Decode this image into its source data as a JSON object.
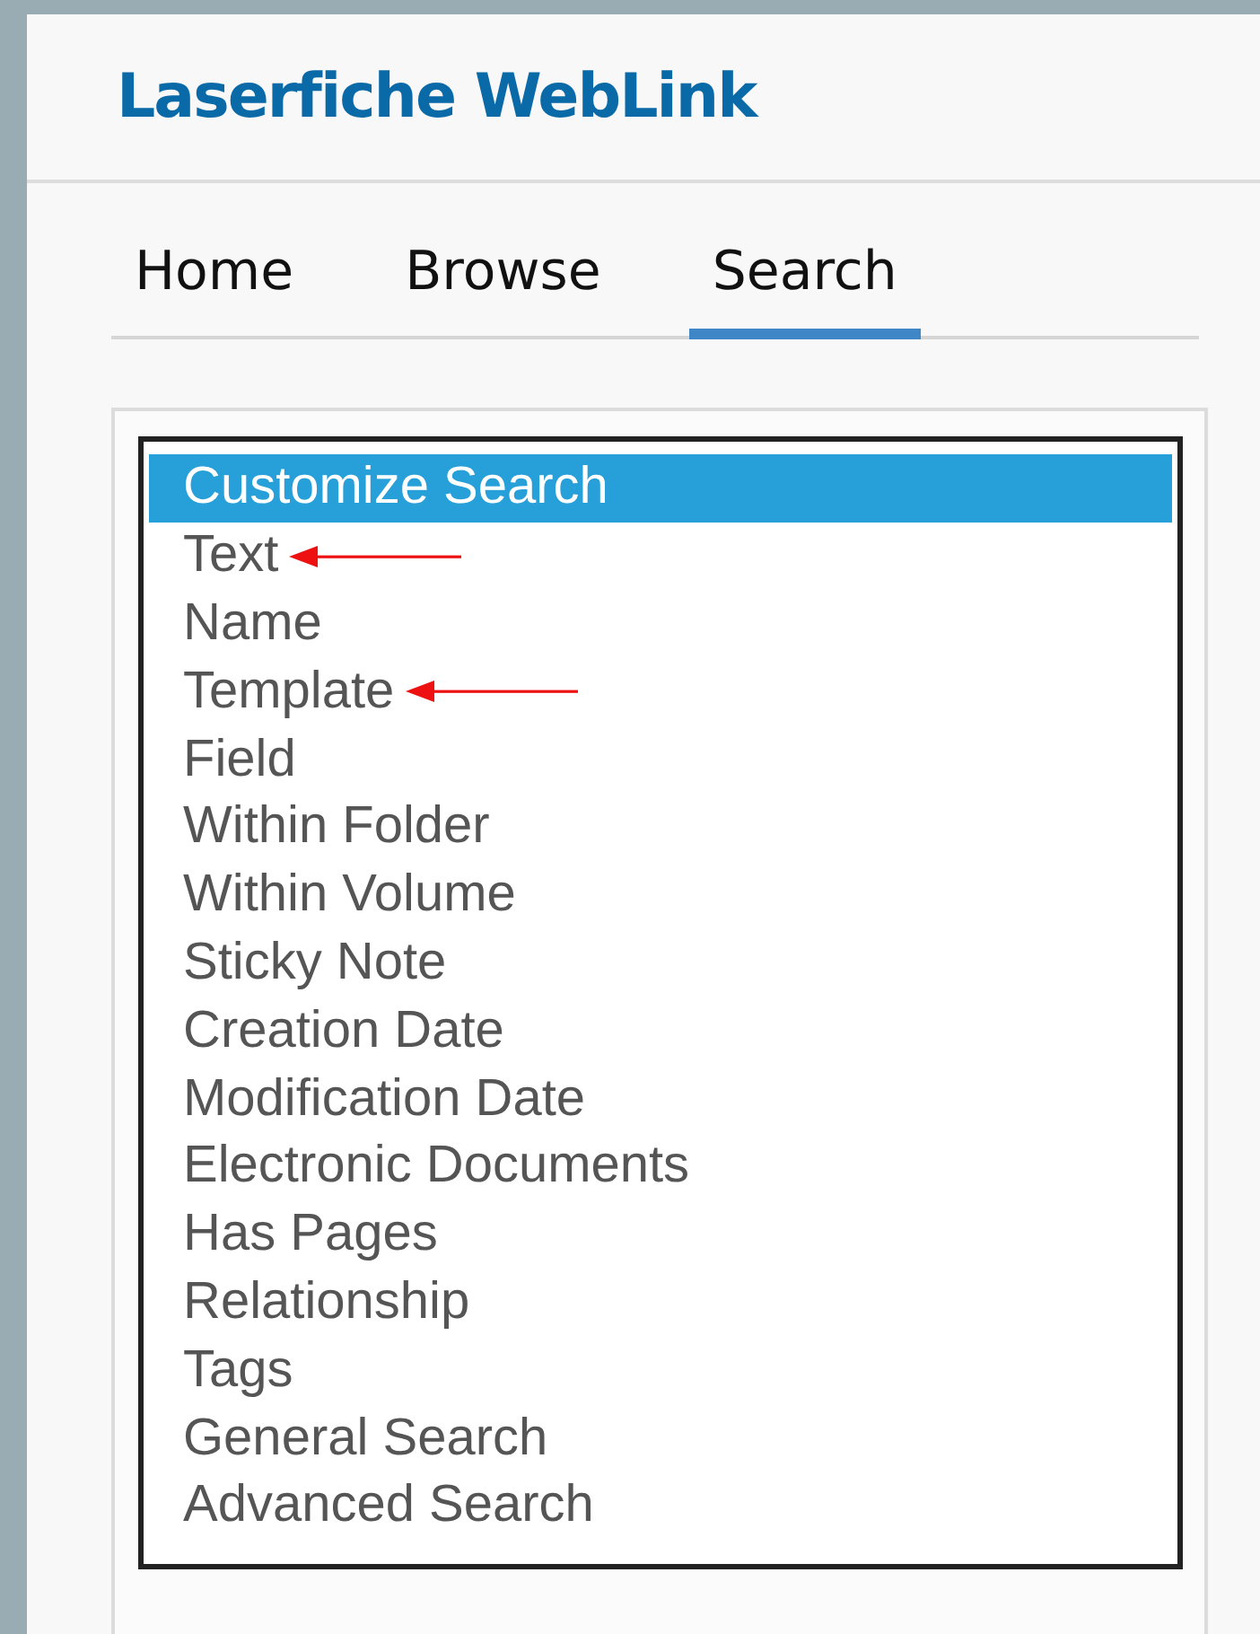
{
  "header": {
    "logo": "Laserfiche WebLink"
  },
  "tabs": [
    {
      "label": "Home",
      "selected": false
    },
    {
      "label": "Browse",
      "selected": false
    },
    {
      "label": "Search",
      "selected": true
    }
  ],
  "search_list": {
    "items": [
      {
        "label": "Customize Search",
        "selected": true,
        "annotated": false
      },
      {
        "label": "Text",
        "selected": false,
        "annotated": true
      },
      {
        "label": "Name",
        "selected": false,
        "annotated": false
      },
      {
        "label": "Template",
        "selected": false,
        "annotated": true
      },
      {
        "label": "Field",
        "selected": false,
        "annotated": false
      },
      {
        "label": "Within Folder",
        "selected": false,
        "annotated": false
      },
      {
        "label": "Within Volume",
        "selected": false,
        "annotated": false
      },
      {
        "label": "Sticky Note",
        "selected": false,
        "annotated": false
      },
      {
        "label": "Creation Date",
        "selected": false,
        "annotated": false
      },
      {
        "label": "Modification Date",
        "selected": false,
        "annotated": false
      },
      {
        "label": "Electronic Documents",
        "selected": false,
        "annotated": false
      },
      {
        "label": "Has Pages",
        "selected": false,
        "annotated": false
      },
      {
        "label": "Relationship",
        "selected": false,
        "annotated": false
      },
      {
        "label": "Tags",
        "selected": false,
        "annotated": false
      },
      {
        "label": "General Search",
        "selected": false,
        "annotated": false
      },
      {
        "label": "Advanced Search",
        "selected": false,
        "annotated": false
      }
    ]
  }
}
